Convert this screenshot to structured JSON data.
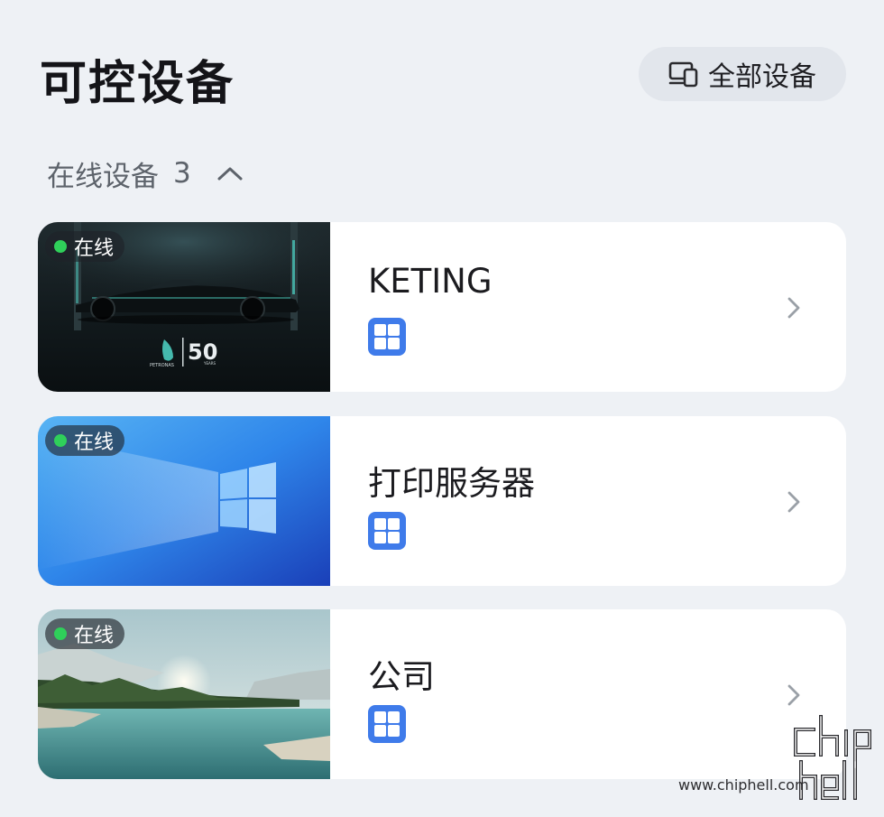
{
  "header": {
    "title": "可控设备",
    "all_devices_label": "全部设备",
    "all_devices_icon": "devices-icon"
  },
  "section": {
    "label": "在线设备",
    "count": "3",
    "toggle_icon": "chevron-up-icon",
    "expanded": true
  },
  "devices": [
    {
      "name": "KETING",
      "status": "在线",
      "os_icon": "windows-icon",
      "thumbnail": "f1-race-car-wallpaper",
      "thumbnail_text": "50",
      "thumbnail_brand": "PETRONAS",
      "thumbnail_sub": "YEARS"
    },
    {
      "name": "打印服务器",
      "status": "在线",
      "os_icon": "windows-icon",
      "thumbnail": "windows-wallpaper"
    },
    {
      "name": "公司",
      "status": "在线",
      "os_icon": "windows-icon",
      "thumbnail": "lake-landscape-wallpaper"
    }
  ],
  "watermark": {
    "logo": "chiphell-logo",
    "url": "www.chiphell.com"
  },
  "colors": {
    "background": "#eef1f5",
    "card": "#ffffff",
    "online_dot": "#2fd05a",
    "os_icon": "#3f7bea"
  }
}
